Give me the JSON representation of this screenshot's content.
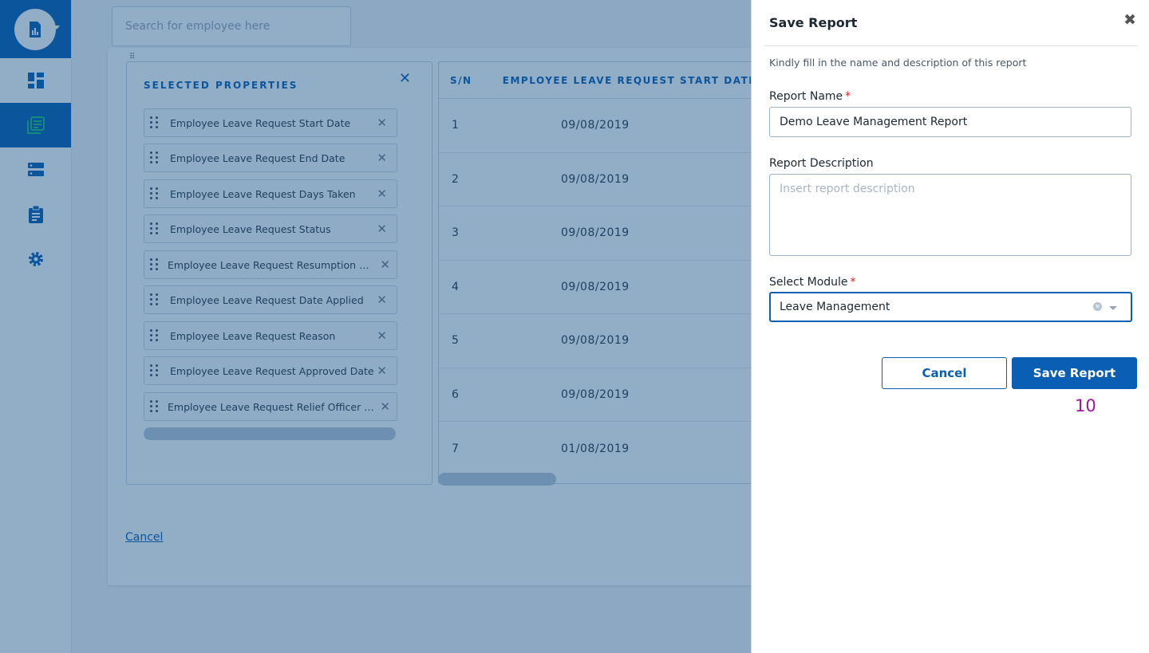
{
  "sidebar": {
    "logo_icon": "report-chart-icon",
    "items": [
      {
        "icon": "dashboard-icon",
        "active": false
      },
      {
        "icon": "reports-icon",
        "active": true
      },
      {
        "icon": "server-list-icon",
        "active": false
      },
      {
        "icon": "clipboard-icon",
        "active": false
      },
      {
        "icon": "settings-icon",
        "active": false
      }
    ]
  },
  "search": {
    "placeholder": "Search for employee here"
  },
  "properties": {
    "title": "SELECTED PROPERTIES",
    "items": [
      "Employee Leave Request Start Date",
      "Employee Leave Request End Date",
      "Employee Leave Request Days Taken",
      "Employee Leave Request Status",
      "Employee Leave Request Resumption Date",
      "Employee Leave Request Date Applied",
      "Employee Leave Request Reason",
      "Employee Leave Request Approved Date",
      "Employee Leave Request Relief Officer Ap..."
    ]
  },
  "table": {
    "headers": [
      "S/N",
      "EMPLOYEE LEAVE REQUEST START DATE"
    ],
    "rows": [
      [
        "1",
        "09/08/2019"
      ],
      [
        "2",
        "09/08/2019"
      ],
      [
        "3",
        "09/08/2019"
      ],
      [
        "4",
        "09/08/2019"
      ],
      [
        "5",
        "09/08/2019"
      ],
      [
        "6",
        "09/08/2019"
      ],
      [
        "7",
        "01/08/2019"
      ]
    ]
  },
  "page": {
    "cancel_link": "Cancel"
  },
  "modal": {
    "title": "Save Report",
    "subtitle": "Kindly fill in the name and description of this report",
    "report_name_label": "Report Name",
    "report_name_value": "Demo Leave Management Report",
    "report_description_label": "Report Description",
    "report_description_placeholder": "Insert report description",
    "select_module_label": "Select Module",
    "select_module_value": "Leave Management",
    "required_mark": "*",
    "cancel_button": "Cancel",
    "save_button": "Save Report",
    "step_number": "10"
  },
  "colors": {
    "brand_blue": "#0a5fb4",
    "required_red": "#d9232d",
    "step_magenta": "#a0189a"
  }
}
